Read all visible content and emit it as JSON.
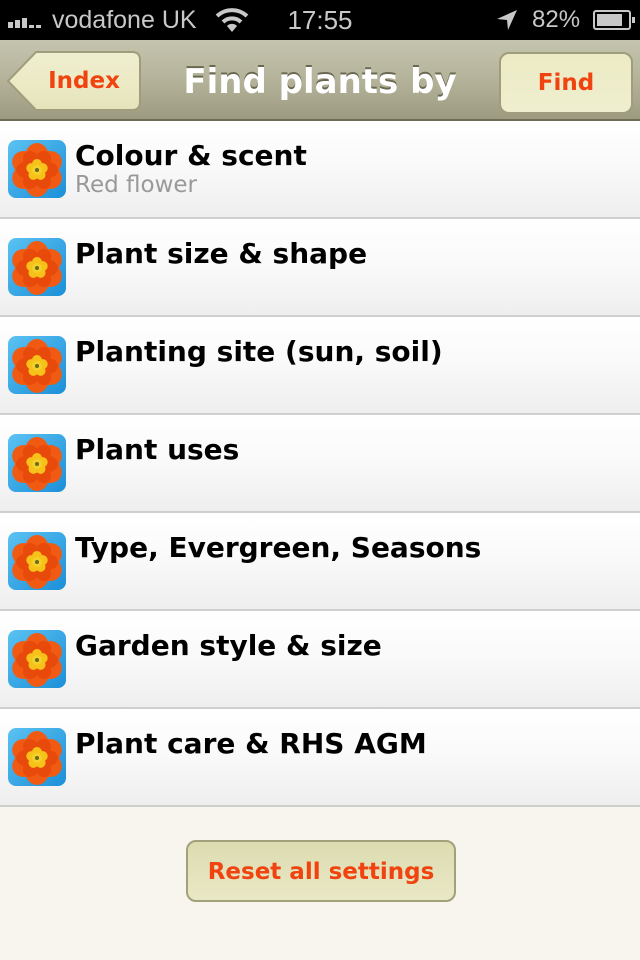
{
  "status_bar": {
    "carrier": "vodafone UK",
    "time": "17:55",
    "battery_percent_label": "82%",
    "battery_level": 0.82,
    "signal_bars": 3,
    "icons": [
      "signal-icon",
      "wifi-icon",
      "location-arrow-icon",
      "battery-icon"
    ]
  },
  "nav": {
    "back_label": "Index",
    "title": "Find plants by",
    "action_label": "Find"
  },
  "colors": {
    "accent": "#f0430f",
    "nav_bar": "#b2b198",
    "button_bg": "#ecebc4",
    "background": "#f7f5ee"
  },
  "list": {
    "items": [
      {
        "title": "Colour & scent",
        "subtitle": "Red flower",
        "icon": "flower-icon"
      },
      {
        "title": "Plant size & shape",
        "subtitle": "",
        "icon": "flower-icon"
      },
      {
        "title": "Planting site (sun, soil)",
        "subtitle": "",
        "icon": "flower-icon"
      },
      {
        "title": "Plant uses",
        "subtitle": "",
        "icon": "flower-icon"
      },
      {
        "title": "Type, Evergreen, Seasons",
        "subtitle": "",
        "icon": "flower-icon"
      },
      {
        "title": "Garden style & size",
        "subtitle": "",
        "icon": "flower-icon"
      },
      {
        "title": "Plant care & RHS AGM",
        "subtitle": "",
        "icon": "flower-icon"
      }
    ]
  },
  "footer": {
    "reset_label": "Reset all settings"
  }
}
